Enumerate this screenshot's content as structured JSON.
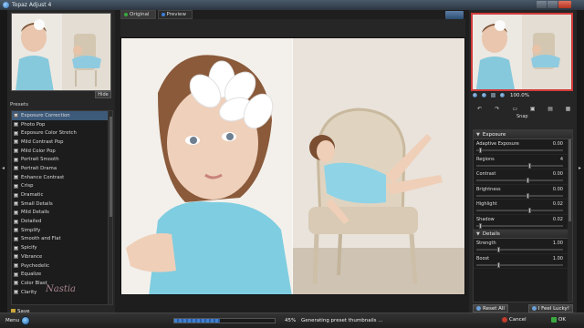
{
  "window": {
    "title": "Topaz Adjust 4"
  },
  "tabs": [
    {
      "label": "Original",
      "dot": "#3aa840"
    },
    {
      "label": "Preview",
      "dot": "#3b7fd6"
    }
  ],
  "left": {
    "hide_label": "Hide",
    "presets_label": "Presets",
    "presets": [
      "Exposure Correction",
      "Photo Pop",
      "Exposure Color Stretch",
      "Mild Contrast Pop",
      "Mild Color Pop",
      "Portrait Smooth",
      "Portrait Drama",
      "Enhance Contrast",
      "Crisp",
      "Dramatic",
      "Small Details",
      "Mild Details",
      "Detailed",
      "Simplify",
      "Smooth and Flat",
      "Spicify",
      "Vibrance",
      "Psychedelic",
      "Equalize",
      "Color Blast",
      "Clarity"
    ],
    "selected_index": 0,
    "save_label": "Save"
  },
  "right": {
    "zoom_value": "100.0%",
    "snap_label": "Snap",
    "exposure_header": "Exposure",
    "exposure_sliders": [
      {
        "label": "Adaptive Exposure",
        "value": "0.00",
        "pos": 0.03
      },
      {
        "label": "Regions",
        "value": "4",
        "pos": 0.62
      },
      {
        "label": "Contrast",
        "value": "0.00",
        "pos": 0.6
      },
      {
        "label": "Brightness",
        "value": "0.00",
        "pos": 0.6
      },
      {
        "label": "Highlight",
        "value": "0.02",
        "pos": 0.62
      },
      {
        "label": "Shadow",
        "value": "0.02",
        "pos": 0.03
      }
    ],
    "details_header": "Details",
    "details_sliders": [
      {
        "label": "Strength",
        "value": "1.00",
        "pos": 0.25
      },
      {
        "label": "Boost",
        "value": "1.00",
        "pos": 0.25
      }
    ],
    "reset_label": "Reset All",
    "lucky_label": "I Feel Lucky!"
  },
  "bottom": {
    "menu_label": "Menu",
    "progress_percent": 45,
    "progress_label": "45%",
    "status": "Generating preset thumbnails ...",
    "cancel_label": "Cancel",
    "ok_label": "OK"
  }
}
